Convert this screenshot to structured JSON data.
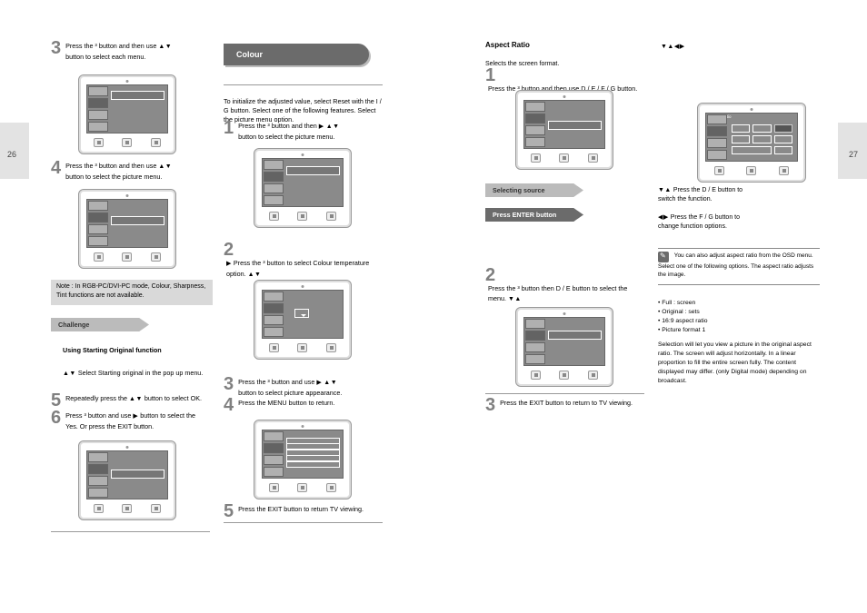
{
  "page_left": "26",
  "page_right": "27",
  "col1": {
    "step3": {
      "n": "3",
      "t": "Press the ³ button and then use",
      "t2": "button to select each menu."
    },
    "step4": {
      "n": "4",
      "t": "Press the ³ button and then use",
      "t2": "button to select the picture menu."
    },
    "note": "Note : In RGB-PC/DVI-PC mode, Colour, Sharpness, Tint functions are not available.",
    "challenge": "Challenge",
    "sub_heading": "Using Starting Original function",
    "sub_sel": {
      "n": "",
      "t": "Select Starting original in the pop up menu."
    },
    "step5": {
      "n": "5",
      "t1": "Repeatedly press the",
      "t2": "button to select OK."
    },
    "step6": {
      "n": "6",
      "t1": "Press ³ button and use",
      "t2": "button to select the",
      "t3": "Yes. Or press the EXIT button."
    }
  },
  "col2": {
    "title": "Colour",
    "intro": "To initialize the adjusted value, select Reset with the I / G button. Select one of the following features. Select the picture menu option.",
    "step1": {
      "n": "1",
      "t": "Press the ³ button and then",
      "t2": "button to select the picture menu."
    },
    "step2": {
      "n": "2",
      "t": "Press the ³ button to select Colour temperature option."
    },
    "step3": {
      "n": "3",
      "t1": "Press the ³ button and use",
      "t2": "button to select picture appearance."
    },
    "step4": {
      "n": "4",
      "t1": "Press the MENU",
      "t2": "button to return."
    },
    "step5": {
      "n": "5",
      "t": "Press the EXIT button to return TV viewing."
    }
  },
  "col3": {
    "section": "Aspect Ratio",
    "intro": "Selects the screen format.",
    "step1": {
      "n": "1",
      "t": "Press the ³ button and then use D / E / F / G button."
    },
    "selecting": "Selecting source",
    "press_enter": "Press ENTER button",
    "press_btn": {
      "t1": "Press the D / E button to",
      "t2": "switch the function."
    },
    "press_lr": {
      "t1": "Press the F / G button to",
      "t2": "change function options."
    },
    "step2": {
      "n": "2",
      "t": "Press the ³ button then D / E button to select the menu."
    },
    "step3": {
      "n": "3",
      "t": "Press the EXIT button to return to TV viewing."
    }
  },
  "col4": {
    "info": "You can also adjust aspect ratio from the OSD menu. Select one of the following options. The aspect ratio adjusts the image.",
    "bullets": {
      "a": "• Full : screen",
      "b": "• Original : sets",
      "c": "• 16:9 aspect ratio",
      "d": "• Picture format 1"
    },
    "long": "Selection will let you view a picture in the original aspect ratio. The screen will adjust horizontally. In a linear proportion to fill the entire screen fully. The content displayed may differ. (only Digital mode) depending on broadcast."
  }
}
